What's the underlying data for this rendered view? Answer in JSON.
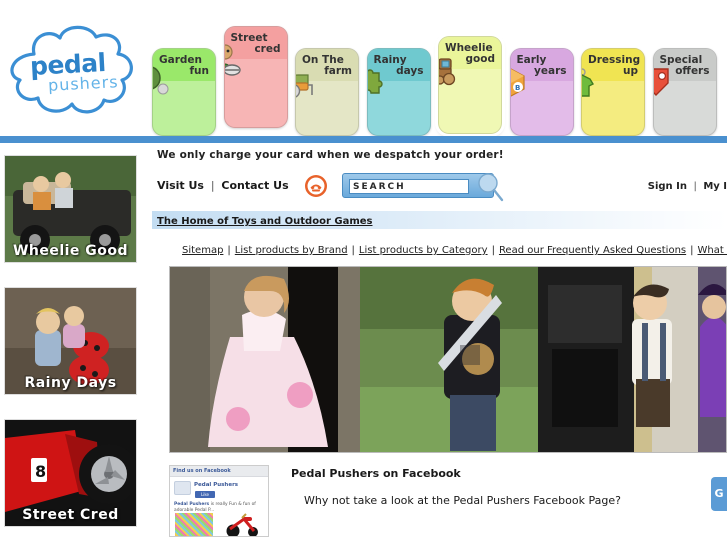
{
  "site": {
    "logo_line1": "pedal",
    "logo_line2": "pushers",
    "logo_color": "#2d82c8"
  },
  "nav": {
    "tabs": [
      {
        "line1": "Garden",
        "line2": "fun",
        "icon": "table-tennis-bat-icon",
        "color": "#9ae86a",
        "head": "#9ae86a",
        "body": "#bdf09b",
        "active": false,
        "raised": false
      },
      {
        "line1": "Street",
        "line2": "cred",
        "icon": "skateboarder-icon",
        "color": "#f4a0a0",
        "head": "#f4a0a0",
        "body": "#f7b5b5",
        "active": false,
        "raised": true
      },
      {
        "line1": "On The",
        "line2": "farm",
        "icon": "tractor-icon",
        "color": "#d9dcb2",
        "head": "#d9dcb2",
        "body": "#e4e6c6",
        "active": false,
        "raised": false
      },
      {
        "line1": "Rainy",
        "line2": "days",
        "icon": "jigsaw-puzzle-icon",
        "color": "#6fc9cf",
        "head": "#6fc9cf",
        "body": "#8fd8dc",
        "active": false,
        "raised": false
      },
      {
        "line1": "Wheelie",
        "line2": "good",
        "icon": "train-icon",
        "color": "#eaf59a",
        "head": "#eaf59a",
        "body": "#f0f8b4",
        "active": true,
        "raised": false
      },
      {
        "line1": "Early",
        "line2": "years",
        "icon": "alphabet-block-icon",
        "color": "#d8a8e0",
        "head": "#d8a8e0",
        "body": "#e3bce9",
        "active": false,
        "raised": false
      },
      {
        "line1": "Dressing",
        "line2": "up",
        "icon": "tshirt-hanger-icon",
        "color": "#f0e452",
        "head": "#f0e452",
        "body": "#f4ec80",
        "active": false,
        "raised": false
      },
      {
        "line1": "Special",
        "line2": "offers",
        "icon": "price-tag-icon",
        "color": "#c9cbc9",
        "head": "#c9cbc9",
        "body": "#d8dad8",
        "active": false,
        "raised": false
      }
    ]
  },
  "sidebar": {
    "cards": [
      {
        "caption": "Wheelie Good"
      },
      {
        "caption": "Rainy Days"
      },
      {
        "caption": "Street Cred"
      }
    ]
  },
  "header": {
    "promo": "We only charge your card when we despatch your order!",
    "visit_us": "Visit Us",
    "contact_us": "Contact Us",
    "separator": "|",
    "sign_in": "Sign In",
    "my_account": "My I",
    "tagline": "The Home of Toys and Outdoor Games"
  },
  "search": {
    "value": "SEARCH",
    "placeholder": "SEARCH"
  },
  "sitemap": {
    "links": [
      "Sitemap",
      "List products by Brand",
      "List products by Category",
      "Read our Frequently Asked Questions",
      "What our customer"
    ],
    "separator": "|"
  },
  "hero": {
    "panes": [
      {
        "alt": "girl-in-pink-princess-dress"
      },
      {
        "alt": "boy-with-sword-knight-costume"
      },
      {
        "alt": "boy-in-victorian-costume"
      },
      {
        "alt": "child-in-purple-witch-costume"
      }
    ]
  },
  "facebook": {
    "title": "Pedal Pushers on Facebook",
    "subtitle": "Why not take a look at the Pedal Pushers Facebook Page?",
    "widget": {
      "header": "Find us on Facebook",
      "page_name": "Pedal Pushers",
      "like_label": "Like",
      "description_bold": "Pedal Pushers",
      "description_rest": " is really Fun & fun of adorable Pedal P..."
    }
  },
  "side_tab": {
    "label": "G"
  }
}
